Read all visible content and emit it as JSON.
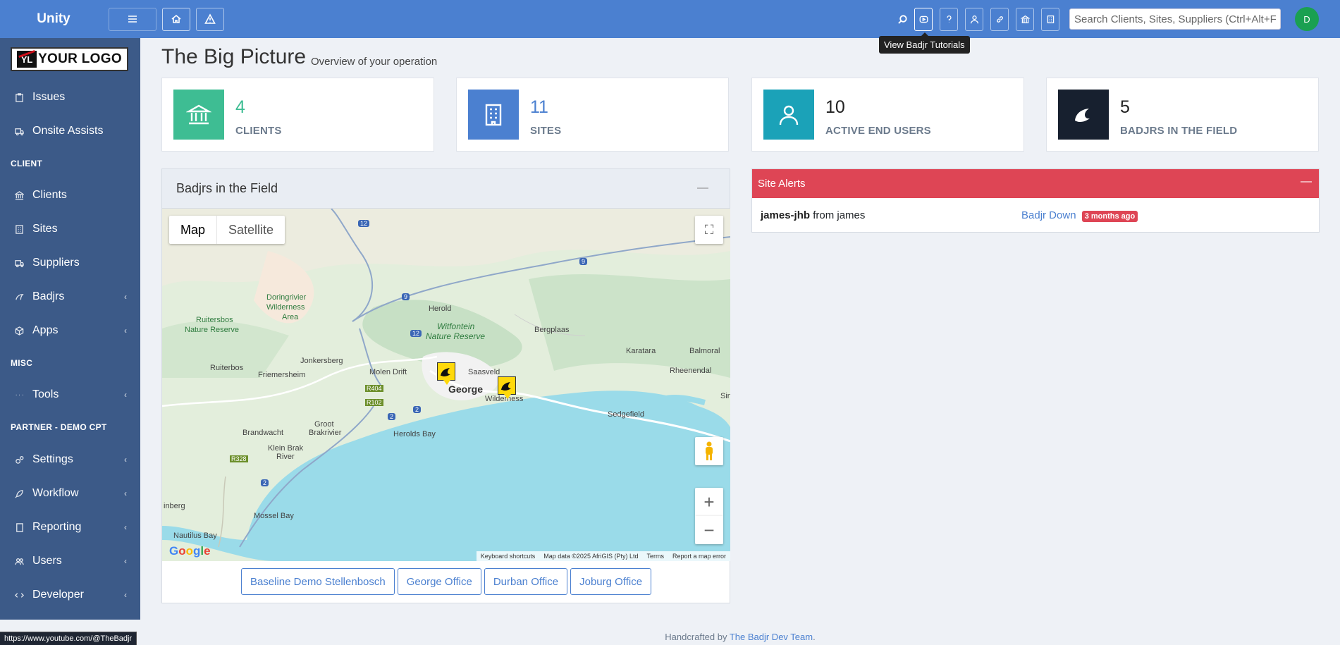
{
  "header": {
    "brand": "Unity",
    "search_placeholder": "Search Clients, Sites, Suppliers (Ctrl+Alt+F)",
    "avatar_initial": "D",
    "tooltip": "View Badjr Tutorials"
  },
  "sidebar": {
    "logo_initials": "YL",
    "logo_text": "YOUR LOGO",
    "items": [
      {
        "label": "Issues",
        "icon": "clipboard-icon"
      },
      {
        "label": "Onsite Assists",
        "icon": "truck-icon"
      },
      {
        "label": "Clients",
        "icon": "bank-icon"
      },
      {
        "label": "Sites",
        "icon": "building-icon"
      },
      {
        "label": "Suppliers",
        "icon": "truck-icon"
      },
      {
        "label": "Badjrs",
        "icon": "badger-icon"
      },
      {
        "label": "Apps",
        "icon": "cube-icon"
      },
      {
        "label": "Tools",
        "icon": "dots-icon"
      },
      {
        "label": "Settings",
        "icon": "cogs-icon"
      },
      {
        "label": "Workflow",
        "icon": "rocket-icon"
      },
      {
        "label": "Reporting",
        "icon": "book-icon"
      },
      {
        "label": "Users",
        "icon": "users-icon"
      },
      {
        "label": "Developer",
        "icon": "code-icon"
      }
    ],
    "sections": [
      "CLIENT",
      "MISC",
      "PARTNER - DEMO CPT"
    ]
  },
  "status_bar_url": "https://www.youtube.com/@TheBadjr",
  "main": {
    "title": "The Big Picture",
    "subtitle": "Overview of your operation",
    "stats": [
      {
        "value": "4",
        "label": "CLIENTS",
        "color": "#3ebd93"
      },
      {
        "value": "11",
        "label": "SITES",
        "color": "#4b80d0"
      },
      {
        "value": "10",
        "label": "ACTIVE END USERS",
        "color": "#1ba2b8"
      },
      {
        "value": "5",
        "label": "BADJRS IN THE FIELD",
        "color": "#17202f"
      }
    ],
    "map_panel": {
      "title": "Badjrs in the Field",
      "map_tab": "Map",
      "satellite_tab": "Satellite",
      "footer": [
        "Keyboard shortcuts",
        "Map data ©2025 AfriGIS (Pty) Ltd",
        "Terms",
        "Report a map error"
      ],
      "locations": [
        "Baseline Demo Stellenbosch",
        "George Office",
        "Durban Office",
        "Joburg Office"
      ]
    },
    "alerts": {
      "title": "Site Alerts",
      "rows": [
        {
          "site": "james-jhb",
          "from": "from james",
          "status": "Badjr Down",
          "time": "3 months ago"
        }
      ]
    }
  },
  "footer": {
    "prefix": "Handcrafted by",
    "team": "The Badjr Dev Team",
    "suffix": "."
  },
  "map_labels": {
    "george": "George",
    "herold": "Herold",
    "doringrivier": "Doringrivier",
    "wilderness_a": "Wilderness",
    "area": "Area",
    "ruitersbos_nr": "Ruitersbos",
    "nature_reserve": "Nature Reserve",
    "witfontein": "Witfontein",
    "witfontein_nr": "Nature Reserve",
    "bergplaas": "Bergplaas",
    "karatara": "Karatara",
    "balmoral": "Balmoral",
    "rheenendal": "Rheenendal",
    "jonkersberg": "Jonkersberg",
    "ruiterbos": "Ruiterbos",
    "friemersheim": "Friemersheim",
    "molen_drift": "Molen Drift",
    "saasveld": "Saasveld",
    "wilderness": "Wilderness",
    "sedgefield": "Sedgefield",
    "brandwacht": "Brandwacht",
    "groot": "Groot",
    "brakrivier": "Brakrivier",
    "herolds_bay": "Herolds Bay",
    "klein_brak": "Klein Brak",
    "river": "River",
    "mossel_bay": "Mossel Bay",
    "nautilus_bay": "Nautilus Bay",
    "hartenbos": "inberg",
    "sin": "Sin",
    "r404": "R404",
    "r102": "R102",
    "r328": "R328",
    "n12": "12",
    "n9": "9",
    "n2": "2"
  }
}
